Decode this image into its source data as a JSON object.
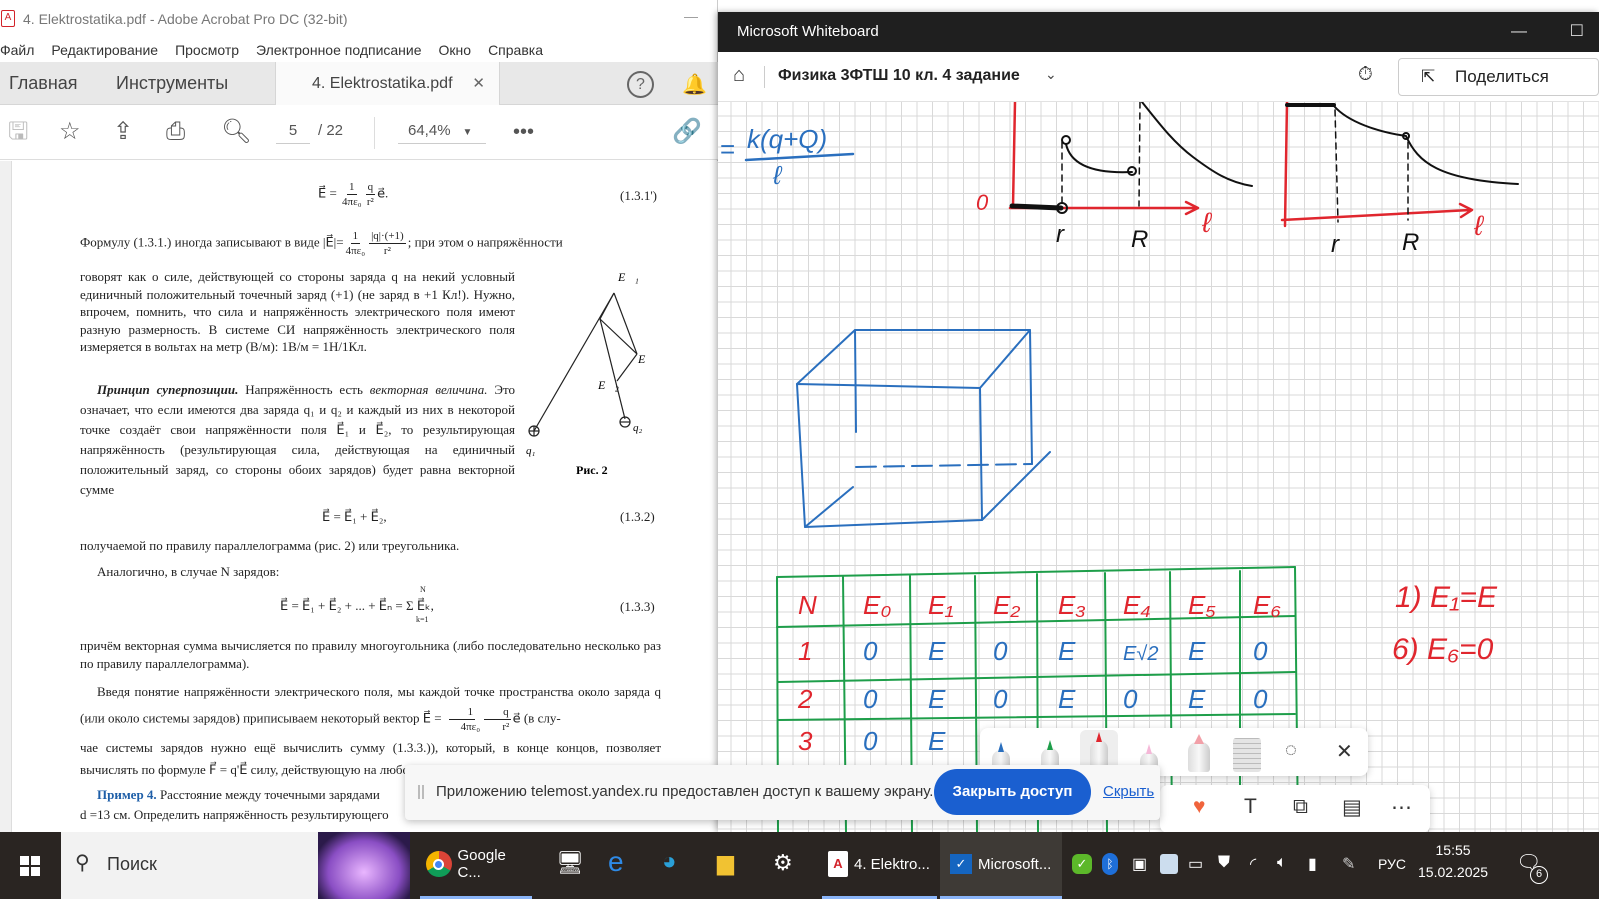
{
  "acrobat": {
    "title": "4. Elektrostatika.pdf - Adobe Acrobat Pro DC (32-bit)",
    "menu": [
      "Файл",
      "Редактирование",
      "Просмотр",
      "Электронное подписание",
      "Окно",
      "Справка"
    ],
    "tabs": {
      "home": "Главная",
      "tools": "Инструменты",
      "doc": "4. Elektrostatika.pdf"
    },
    "toolbar": {
      "page_current": "5",
      "page_total": "/ 22",
      "zoom": "64,4%"
    },
    "doc": {
      "eq1": {
        "lhs": "E⃗ =",
        "num": "1",
        "den": "4πε₀",
        "num2": "q",
        "den2": "r²",
        "tail": "e⃗.",
        "number": "(1.3.1')"
      },
      "p1a": "Формулу (1.3.1.) иногда записывают в виде |E⃗|=",
      "p1num": "1",
      "p1den": "4πε₀",
      "p1num2": "|q|·(+1)",
      "p1den2": "r²",
      "p1b": "; при этом о напряжённости",
      "p2": "говорят как о силе, действующей со стороны заряда q на некий условный единичный положительный точечный заряд (+1) (не заряд в +1 Кл!). Нужно, впрочем, помнить, что сила и напряжённость электрического поля имеют разную размерность. В системе СИ напряжённость электрического поля измеряется в вольтах на метр (В/м): 1В/м = 1Н/1Кл.",
      "p3_bold": "Принцип суперпозиции.",
      "p3_a": " Напряжённость есть ",
      "p3_it": "векторная величина.",
      "p3_b": " Это означает, что если имеются два заряда q₁ и q₂ и каждый из них в некоторой точке создаёт свои напряжённости поля E⃗₁ и E⃗₂, то результирующая напряжённость (результирующая сила, действующая на единичный положительный заряд, со стороны обоих зарядов) будет равна векторной сумме",
      "eq2": {
        "text": "E⃗ = E⃗₁ + E⃗₂,",
        "number": "(1.3.2)"
      },
      "p4": "получаемой по правилу параллелограмма (рис. 2) или треугольника.",
      "p5": "Аналогично, в случае N зарядов:",
      "eq3": {
        "text": "E⃗ = E⃗₁ + E⃗₂ + ... + E⃗ₙ = Σ E⃗ₖ,",
        "sum_top": "N",
        "sum_bottom": "k=1",
        "number": "(1.3.3)"
      },
      "p6": "причём векторная сумма вычисляется по правилу многоугольника (либо последовательно несколько раз по правилу параллелограмма).",
      "p7a": "Введя понятие напряжённости электрического поля, мы каждой точке пространства около заряда q (или около системы зарядов) приписываем некоторый вектор E⃗ =",
      "p7num": "1",
      "p7den": "4πε₀",
      "p7num2": "q",
      "p7den2": "r²",
      "p7b": "e⃗ (в слу-",
      "p8": "чае системы зарядов нужно ещё вычислить сумму (1.3.3.)), который, в конце концов, позволяет вычислять по формуле F⃗ = q'E⃗ силу, действующую на любой другой заряд q'",
      "ex_label": "Пример 4.",
      "ex_text": " Расстояние между точечными зарядами",
      "ex_line2": "d =13 см. Определить напряжённость результирующего",
      "figure": {
        "caption": "Рис. 2",
        "E1": "E⃗₁",
        "E2": "E⃗₂",
        "E": "E⃗",
        "q1": "q₁",
        "q2": "q₂"
      }
    }
  },
  "whiteboard": {
    "app_title": "Microsoft Whiteboard",
    "board_title": "Физика 3ФТШ 10 кл. 4 задание",
    "share_label": "Поделиться",
    "drawings": {
      "formula_num": "k(q+Q)",
      "formula_den": "ℓ",
      "formula_eq": "=",
      "graph1": {
        "zero": "0",
        "r": "r",
        "R": "R",
        "axis": "ℓ"
      },
      "graph2": {
        "r": "r",
        "R": "R",
        "axis": "ℓ"
      },
      "notes": [
        "1) E₁=E",
        "6) E₆=0"
      ]
    },
    "table": {
      "headers": [
        "N",
        "E₀",
        "E₁",
        "E₂",
        "E₃",
        "E₄",
        "E₅",
        "E₆"
      ],
      "rows": [
        [
          "1",
          "0",
          "E",
          "0",
          "E",
          "E√2",
          "E",
          "0"
        ],
        [
          "2",
          "0",
          "E",
          "0",
          "E",
          "0",
          "E",
          "0"
        ],
        [
          "3",
          "0",
          "E",
          "",
          "",
          "",
          "",
          ""
        ]
      ]
    }
  },
  "sharebar": {
    "message": "Приложению telemost.yandex.ru предоставлен доступ к вашему экрану.",
    "close_label": "Закрыть доступ",
    "hide_label": "Скрыть"
  },
  "taskbar": {
    "search_label": "Поиск",
    "apps": [
      {
        "label": "Google C..."
      },
      {
        "label": "4. Elektro..."
      },
      {
        "label": "Microsoft..."
      }
    ],
    "language": "РУС",
    "time": "15:55",
    "date": "15.02.2025",
    "notifications": "6"
  },
  "colors": {
    "accent": "#1a5fd0",
    "red_ink": "#e0262e",
    "blue_ink": "#2a6fbe",
    "green_ink": "#1e9e4a"
  }
}
